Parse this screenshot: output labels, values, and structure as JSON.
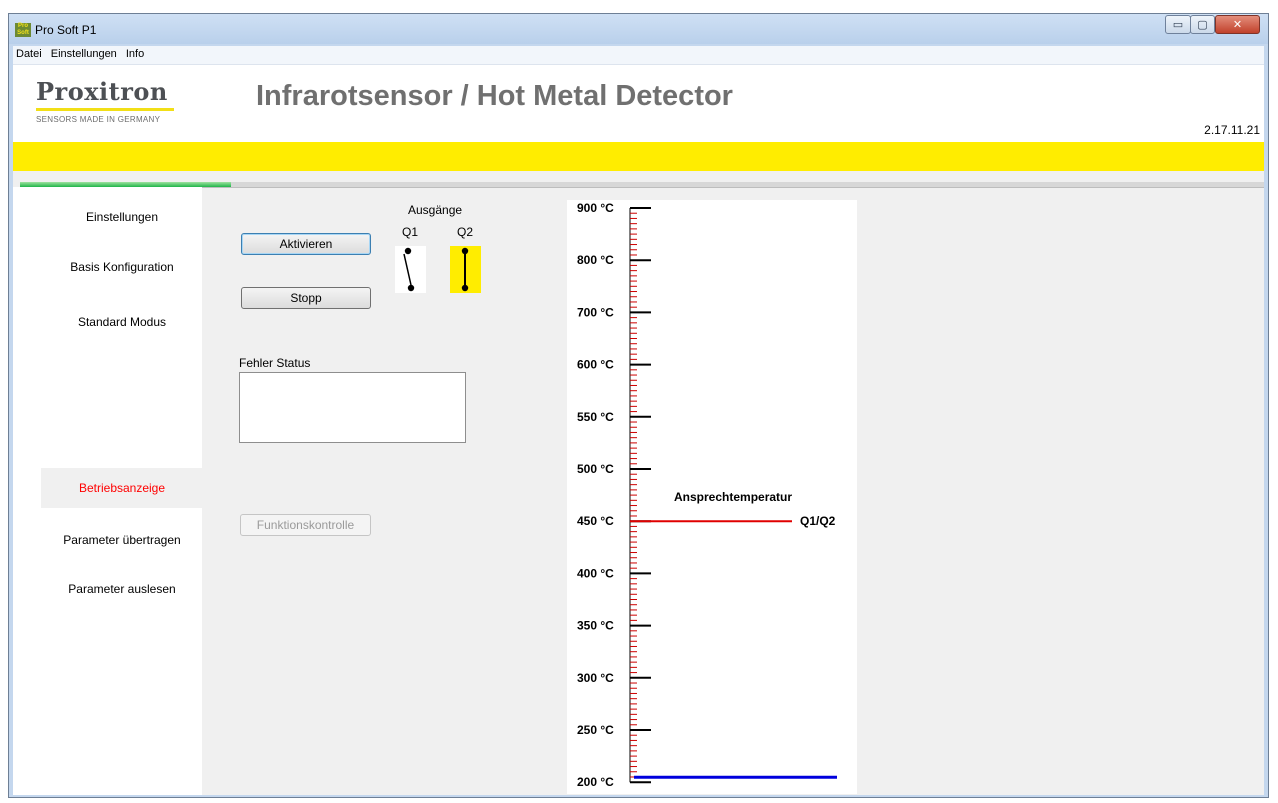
{
  "window": {
    "title": "Pro Soft P1",
    "icon": {
      "name": "app-icon",
      "lines": [
        "Pro",
        "Soft"
      ]
    },
    "controls": {
      "minimize": "▭",
      "maximize": "▢",
      "close": "✕"
    }
  },
  "menu": [
    "Datei",
    "Einstellungen",
    "Info"
  ],
  "header": {
    "logo_text": "Proxitron",
    "logo_tagline": "SENSORS MADE IN GERMANY",
    "title": "Infrarotsensor / Hot Metal Detector",
    "version": "2.17.11.21"
  },
  "colors": {
    "accent_yellow": "#ffed00",
    "active_red": "#ff0000",
    "threshold_red": "#e00000",
    "current_blue": "#0000dd",
    "progress_green": "#1fb54a"
  },
  "progress": {
    "fraction": 0.17
  },
  "sidebar": {
    "items": [
      {
        "label": "Einstellungen",
        "active": false
      },
      {
        "label": "Basis Konfiguration",
        "active": false
      },
      {
        "label": "Standard Modus",
        "active": false
      },
      {
        "label": "Betriebsanzeige",
        "active": true
      },
      {
        "label": "Parameter übertragen",
        "active": false
      },
      {
        "label": "Parameter auslesen",
        "active": false
      }
    ]
  },
  "controls": {
    "activate_label": "Aktivieren",
    "stop_label": "Stopp",
    "function_check_label": "Funktionskontrolle",
    "function_check_enabled": false,
    "error_status_label": "Fehler Status",
    "error_status_value": ""
  },
  "outputs": {
    "heading": "Ausgänge",
    "q1": {
      "label": "Q1",
      "state": "open",
      "highlight": false
    },
    "q2": {
      "label": "Q2",
      "state": "closed",
      "highlight": true
    }
  },
  "gauge": {
    "tick_labels": [
      "900 °C",
      "800 °C",
      "700 °C",
      "600 °C",
      "550 °C",
      "500 °C",
      "450 °C",
      "400 °C",
      "350 °C",
      "300 °C",
      "250 °C",
      "200 °C"
    ],
    "threshold_title": "Ansprechtemperatur",
    "threshold_output_label": "Q1/Q2",
    "threshold_value_label": "450 °C",
    "current_value_label": "200 °C"
  }
}
